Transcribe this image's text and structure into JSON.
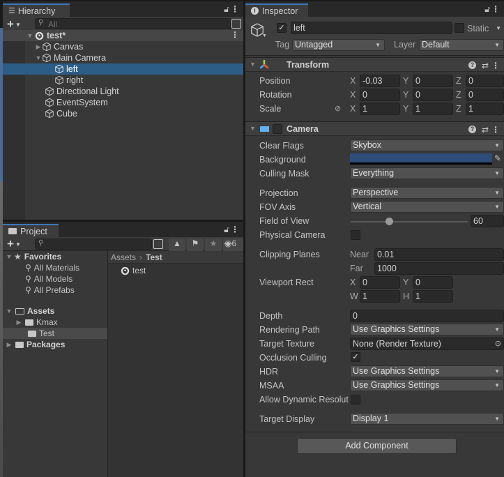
{
  "hierarchy": {
    "tab_label": "Hierarchy",
    "search_placeholder": "All",
    "scene": {
      "name": "test*"
    },
    "items": [
      {
        "label": "Canvas",
        "expandable": true,
        "expanded": false,
        "depth": 1
      },
      {
        "label": "Main Camera",
        "expandable": true,
        "expanded": true,
        "depth": 1
      },
      {
        "label": "left",
        "expandable": false,
        "depth": 2,
        "selected": true
      },
      {
        "label": "right",
        "expandable": false,
        "depth": 2
      },
      {
        "label": "Directional Light",
        "expandable": false,
        "depth": 1
      },
      {
        "label": "EventSystem",
        "expandable": false,
        "depth": 1
      },
      {
        "label": "Cube",
        "expandable": false,
        "depth": 1
      }
    ]
  },
  "project": {
    "tab_label": "Project",
    "hidden_count": "6",
    "favorites": {
      "label": "Favorites",
      "items": [
        "All Materials",
        "All Models",
        "All Prefabs"
      ]
    },
    "assets": {
      "label": "Assets",
      "children": [
        "Kmax",
        "Test"
      ]
    },
    "packages_label": "Packages",
    "breadcrumb": {
      "root": "Assets",
      "current": "Test"
    },
    "files": [
      "test"
    ]
  },
  "inspector": {
    "tab_label": "Inspector",
    "object": {
      "active": true,
      "name": "left",
      "static_label": "Static",
      "static": false,
      "tag_label": "Tag",
      "tag_value": "Untagged",
      "layer_label": "Layer",
      "layer_value": "Default"
    },
    "transform": {
      "title": "Transform",
      "rows": [
        {
          "label": "Position",
          "x": "-0.03",
          "y": "0",
          "z": "0"
        },
        {
          "label": "Rotation",
          "x": "0",
          "y": "0",
          "z": "0"
        },
        {
          "label": "Scale",
          "x": "1",
          "y": "1",
          "z": "1"
        }
      ]
    },
    "camera": {
      "title": "Camera",
      "enabled": false,
      "clear_flags": {
        "label": "Clear Flags",
        "value": "Skybox"
      },
      "background": {
        "label": "Background",
        "color": "#2f4d7a"
      },
      "culling_mask": {
        "label": "Culling Mask",
        "value": "Everything"
      },
      "projection": {
        "label": "Projection",
        "value": "Perspective"
      },
      "fov_axis": {
        "label": "FOV Axis",
        "value": "Vertical"
      },
      "field_of_view": {
        "label": "Field of View",
        "value": "60",
        "slider_fraction": 0.33
      },
      "physical_camera": {
        "label": "Physical Camera",
        "checked": false
      },
      "clipping_planes": {
        "label": "Clipping Planes",
        "near_label": "Near",
        "near": "0.01",
        "far_label": "Far",
        "far": "1000"
      },
      "viewport_rect": {
        "label": "Viewport Rect",
        "x": "0",
        "y": "0",
        "w": "1",
        "h": "1"
      },
      "depth": {
        "label": "Depth",
        "value": "0"
      },
      "rendering_path": {
        "label": "Rendering Path",
        "value": "Use Graphics Settings"
      },
      "target_texture": {
        "label": "Target Texture",
        "value": "None (Render Texture)"
      },
      "occlusion_culling": {
        "label": "Occlusion Culling",
        "checked": true
      },
      "hdr": {
        "label": "HDR",
        "value": "Use Graphics Settings"
      },
      "msaa": {
        "label": "MSAA",
        "value": "Use Graphics Settings"
      },
      "dynamic_resolution": {
        "label": "Allow Dynamic Resolut",
        "checked": false
      },
      "target_display": {
        "label": "Target Display",
        "value": "Display 1"
      }
    },
    "add_component_label": "Add Component"
  },
  "axis_labels": {
    "x": "X",
    "y": "Y",
    "z": "Z",
    "w": "W",
    "h": "H"
  },
  "colors": {
    "selection": "#2c5d87",
    "tab_accent": "#3a79bb",
    "camera_icon": "#5fb2f5"
  }
}
